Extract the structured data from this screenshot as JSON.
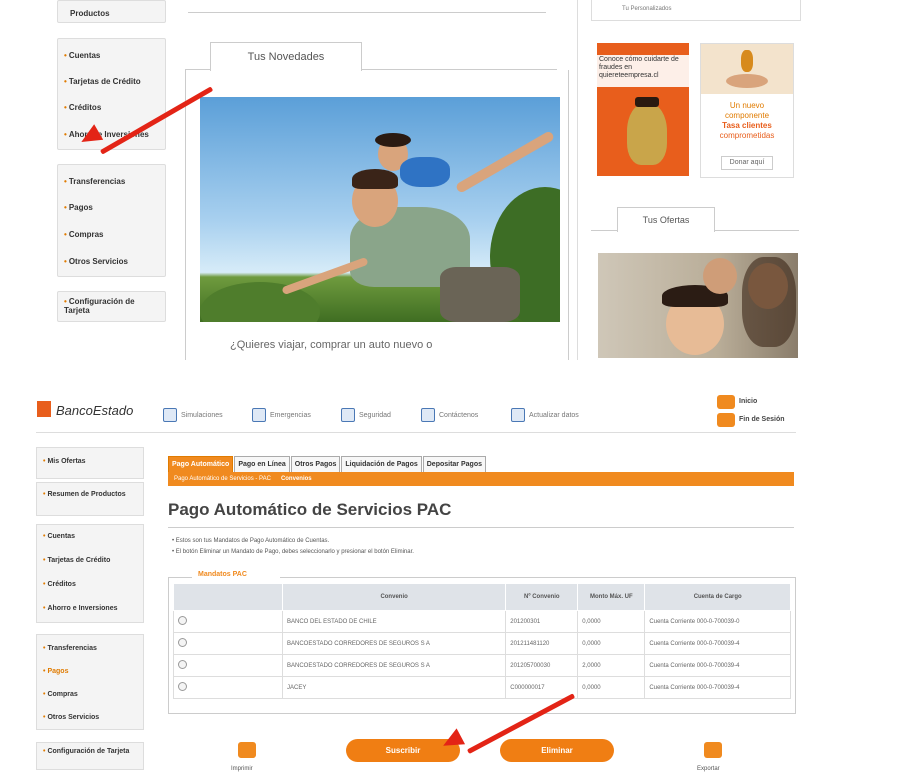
{
  "top": {
    "sidebar_top_label": "Productos",
    "sidebar_group1": [
      "Cuentas",
      "Tarjetas de Crédito",
      "Créditos",
      "Ahorro e Inversiones"
    ],
    "sidebar_group2": [
      "Transferencias",
      "Pagos",
      "Compras",
      "Otros Servicios"
    ],
    "sidebar_config": "Configuración de Tarjeta",
    "tab_novedades": "Tus Novedades",
    "promo_caption": "¿Quieres viajar, comprar un auto nuevo o",
    "right_top_label": "Tu Personalizados",
    "ad_orange_text": "Conoce cómo cuidarte de fraudes en quiereteempresa.cl",
    "ad_cream_text": [
      "Un nuevo",
      "componente",
      "Tasa clientes",
      "comprometidas"
    ],
    "ad_cream_link": "Donar aquí",
    "tab_ofertas": "Tus Ofertas"
  },
  "bottom": {
    "brand": "BancoEstado",
    "topnav": [
      "Simulaciones",
      "Emergencias",
      "Seguridad",
      "Contáctenos",
      "Actualizar datos"
    ],
    "right_links": [
      "Inicio",
      "Fin de Sesión"
    ],
    "sidebar": {
      "mis_ofertas": "Mis Ofertas",
      "resumen": "Resumen de Productos",
      "group1": [
        "Cuentas",
        "Tarjetas de Crédito",
        "Créditos",
        "Ahorro e Inversiones"
      ],
      "group2": [
        "Transferencias",
        "Pagos",
        "Compras",
        "Otros Servicios"
      ],
      "config": "Configuración de Tarjeta"
    },
    "tabs": [
      "Pago Automático",
      "Pago en Línea",
      "Otros Pagos",
      "Liquidación de Pagos",
      "Depositar Pagos"
    ],
    "subbar": "Pago Automático de Servicios - PAC",
    "subbar_link": "Convenios",
    "page_title": "Pago Automático de Servicios PAC",
    "instructions": [
      "Estos son tus Mandatos de Pago Automático de Cuentas.",
      "El botón Eliminar un Mandato de Pago, debes seleccionarlo y presionar el botón Eliminar."
    ],
    "section_label": "Mandatos PAC",
    "table": {
      "headers": [
        "",
        "Convenio",
        "Nº Convenio",
        "Monto Máx. UF",
        "Cuenta de Cargo"
      ],
      "rows": [
        [
          "BANCO DEL ESTADO DE CHILE",
          "201200301",
          "0,0000",
          "Cuenta Corriente 000-0-700039-0"
        ],
        [
          "BANCOESTADO CORREDORES DE SEGUROS S A",
          "201211481120",
          "0,0000",
          "Cuenta Corriente 000-0-700039-4"
        ],
        [
          "BANCOESTADO CORREDORES DE SEGUROS S A",
          "201205700030",
          "2,0000",
          "Cuenta Corriente 000-0-700039-4"
        ],
        [
          "JACEY",
          "C000000017",
          "0,0000",
          "Cuenta Corriente 000-0-700039-4"
        ]
      ]
    },
    "buttons": {
      "suscribir": "Suscribir",
      "eliminar": "Eliminar"
    },
    "icons": {
      "imprimir": "Imprimir",
      "exportar": "Exportar"
    }
  },
  "colors": {
    "accent": "#f08a1f",
    "arrow": "#e32416"
  }
}
